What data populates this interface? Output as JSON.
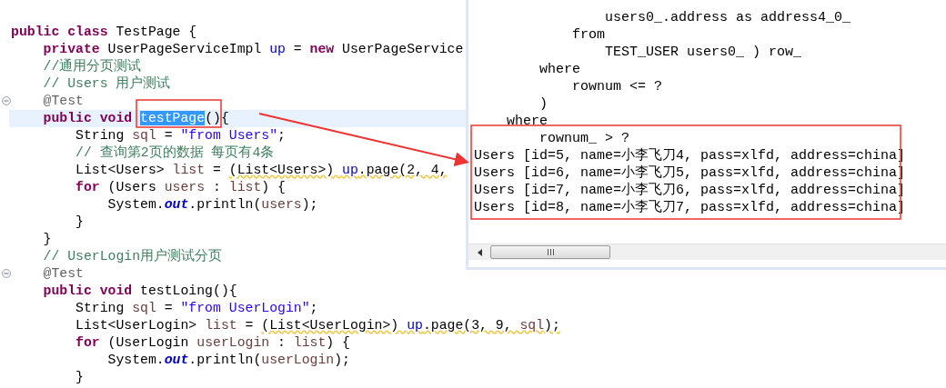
{
  "editor": {
    "lines": [
      {
        "current": false,
        "fold": false,
        "tokens": [
          {
            "kind": "keyword",
            "text": "public class",
            "selected": false,
            "warning": false
          },
          {
            "kind": "plain",
            "text": " TestPage {",
            "selected": false,
            "warning": false
          }
        ]
      },
      {
        "current": false,
        "fold": false,
        "tokens": [
          {
            "kind": "keyword",
            "text": "    private",
            "selected": false,
            "warning": false
          },
          {
            "kind": "plain",
            "text": " UserPageServiceImpl ",
            "selected": false,
            "warning": false
          },
          {
            "kind": "field",
            "text": "up",
            "selected": false,
            "warning": false
          },
          {
            "kind": "plain",
            "text": " = ",
            "selected": false,
            "warning": false
          },
          {
            "kind": "keyword",
            "text": "new",
            "selected": false,
            "warning": false
          },
          {
            "kind": "plain",
            "text": " UserPageService",
            "selected": false,
            "warning": false
          }
        ]
      },
      {
        "current": false,
        "fold": false,
        "tokens": [
          {
            "kind": "comment",
            "text": "    //通用分页测试",
            "selected": false,
            "warning": false
          }
        ]
      },
      {
        "current": false,
        "fold": false,
        "tokens": [
          {
            "kind": "comment",
            "text": "    // Users 用户测试",
            "selected": false,
            "warning": false
          }
        ]
      },
      {
        "current": false,
        "fold": true,
        "tokens": [
          {
            "kind": "annotation",
            "text": "    @Test",
            "selected": false,
            "warning": false
          }
        ]
      },
      {
        "current": true,
        "fold": false,
        "tokens": [
          {
            "kind": "keyword",
            "text": "    public void ",
            "selected": false,
            "warning": false
          },
          {
            "kind": "plain",
            "text": "testPage",
            "selected": true,
            "warning": false
          },
          {
            "kind": "plain",
            "text": "(){",
            "selected": false,
            "warning": false
          }
        ]
      },
      {
        "current": false,
        "fold": false,
        "tokens": [
          {
            "kind": "plain",
            "text": "        String ",
            "selected": false,
            "warning": false
          },
          {
            "kind": "local",
            "text": "sql",
            "selected": false,
            "warning": false
          },
          {
            "kind": "plain",
            "text": " = ",
            "selected": false,
            "warning": false
          },
          {
            "kind": "string",
            "text": "\"from Users\"",
            "selected": false,
            "warning": false
          },
          {
            "kind": "plain",
            "text": ";",
            "selected": false,
            "warning": false
          }
        ]
      },
      {
        "current": false,
        "fold": false,
        "tokens": [
          {
            "kind": "comment",
            "text": "        // 查询第2页的数据 每页有4条",
            "selected": false,
            "warning": false
          }
        ]
      },
      {
        "current": false,
        "fold": false,
        "tokens": [
          {
            "kind": "plain",
            "text": "        List<Users> ",
            "selected": false,
            "warning": false
          },
          {
            "kind": "local",
            "text": "list",
            "selected": false,
            "warning": false
          },
          {
            "kind": "plain",
            "text": " = ",
            "selected": false,
            "warning": false
          },
          {
            "kind": "plain",
            "text": "(List<Users>) ",
            "selected": false,
            "warning": true
          },
          {
            "kind": "field",
            "text": "up",
            "selected": false,
            "warning": true
          },
          {
            "kind": "plain",
            "text": ".page(2, 4,",
            "selected": false,
            "warning": true
          }
        ]
      },
      {
        "current": false,
        "fold": false,
        "tokens": [
          {
            "kind": "keyword",
            "text": "        for",
            "selected": false,
            "warning": false
          },
          {
            "kind": "plain",
            "text": " (Users ",
            "selected": false,
            "warning": false
          },
          {
            "kind": "local",
            "text": "users",
            "selected": false,
            "warning": false
          },
          {
            "kind": "plain",
            "text": " : ",
            "selected": false,
            "warning": false
          },
          {
            "kind": "local",
            "text": "list",
            "selected": false,
            "warning": false
          },
          {
            "kind": "plain",
            "text": ") {",
            "selected": false,
            "warning": false
          }
        ]
      },
      {
        "current": false,
        "fold": false,
        "tokens": [
          {
            "kind": "plain",
            "text": "            System.",
            "selected": false,
            "warning": false
          },
          {
            "kind": "static",
            "text": "out",
            "selected": false,
            "warning": false
          },
          {
            "kind": "plain",
            "text": ".println(",
            "selected": false,
            "warning": false
          },
          {
            "kind": "local",
            "text": "users",
            "selected": false,
            "warning": false
          },
          {
            "kind": "plain",
            "text": ");",
            "selected": false,
            "warning": false
          }
        ]
      },
      {
        "current": false,
        "fold": false,
        "tokens": [
          {
            "kind": "plain",
            "text": "        }",
            "selected": false,
            "warning": false
          }
        ]
      },
      {
        "current": false,
        "fold": false,
        "tokens": [
          {
            "kind": "plain",
            "text": "    }",
            "selected": false,
            "warning": false
          }
        ]
      },
      {
        "current": false,
        "fold": false,
        "tokens": [
          {
            "kind": "comment",
            "text": "    // UserLogin用户测试分页",
            "selected": false,
            "warning": false
          }
        ]
      },
      {
        "current": false,
        "fold": true,
        "tokens": [
          {
            "kind": "annotation",
            "text": "    @Test",
            "selected": false,
            "warning": false
          }
        ]
      },
      {
        "current": false,
        "fold": false,
        "tokens": [
          {
            "kind": "keyword",
            "text": "    public void",
            "selected": false,
            "warning": false
          },
          {
            "kind": "plain",
            "text": " testLoing(){",
            "selected": false,
            "warning": false
          }
        ]
      },
      {
        "current": false,
        "fold": false,
        "tokens": [
          {
            "kind": "plain",
            "text": "        String ",
            "selected": false,
            "warning": false
          },
          {
            "kind": "local",
            "text": "sql",
            "selected": false,
            "warning": false
          },
          {
            "kind": "plain",
            "text": " = ",
            "selected": false,
            "warning": false
          },
          {
            "kind": "string",
            "text": "\"from UserLogin\"",
            "selected": false,
            "warning": false
          },
          {
            "kind": "plain",
            "text": ";",
            "selected": false,
            "warning": false
          }
        ]
      },
      {
        "current": false,
        "fold": false,
        "tokens": [
          {
            "kind": "plain",
            "text": "        List<UserLogin> ",
            "selected": false,
            "warning": false
          },
          {
            "kind": "local",
            "text": "list",
            "selected": false,
            "warning": false
          },
          {
            "kind": "plain",
            "text": " = ",
            "selected": false,
            "warning": false
          },
          {
            "kind": "plain",
            "text": "(List<UserLogin>) ",
            "selected": false,
            "warning": true
          },
          {
            "kind": "field",
            "text": "up",
            "selected": false,
            "warning": true
          },
          {
            "kind": "plain",
            "text": ".page(3, 9, ",
            "selected": false,
            "warning": true
          },
          {
            "kind": "local",
            "text": "sql",
            "selected": false,
            "warning": true
          },
          {
            "kind": "plain",
            "text": ");",
            "selected": false,
            "warning": true
          }
        ]
      },
      {
        "current": false,
        "fold": false,
        "tokens": [
          {
            "kind": "keyword",
            "text": "        for",
            "selected": false,
            "warning": false
          },
          {
            "kind": "plain",
            "text": " (UserLogin ",
            "selected": false,
            "warning": false
          },
          {
            "kind": "local",
            "text": "userLogin",
            "selected": false,
            "warning": false
          },
          {
            "kind": "plain",
            "text": " : ",
            "selected": false,
            "warning": false
          },
          {
            "kind": "local",
            "text": "list",
            "selected": false,
            "warning": false
          },
          {
            "kind": "plain",
            "text": ") {",
            "selected": false,
            "warning": false
          }
        ]
      },
      {
        "current": false,
        "fold": false,
        "tokens": [
          {
            "kind": "plain",
            "text": "            System.",
            "selected": false,
            "warning": false
          },
          {
            "kind": "static",
            "text": "out",
            "selected": false,
            "warning": false
          },
          {
            "kind": "plain",
            "text": ".println(",
            "selected": false,
            "warning": false
          },
          {
            "kind": "local",
            "text": "userLogin",
            "selected": false,
            "warning": false
          },
          {
            "kind": "plain",
            "text": ");",
            "selected": false,
            "warning": false
          }
        ]
      },
      {
        "current": false,
        "fold": false,
        "tokens": [
          {
            "kind": "plain",
            "text": "        }",
            "selected": false,
            "warning": false
          }
        ]
      }
    ]
  },
  "console": {
    "lines": [
      "                users0_.address as address4_0_",
      "            from",
      "                TEST_USER users0_ ) row_",
      "        where",
      "            rownum <= ?",
      "        )",
      "    where",
      "        rownum_ > ?",
      "Users [id=5, name=小李飞刀4, pass=xlfd, address=china]",
      "Users [id=6, name=小李飞刀5, pass=xlfd, address=china]",
      "Users [id=7, name=小李飞刀6, pass=xlfd, address=china]",
      "Users [id=8, name=小李飞刀7, pass=xlfd, address=china]"
    ]
  }
}
